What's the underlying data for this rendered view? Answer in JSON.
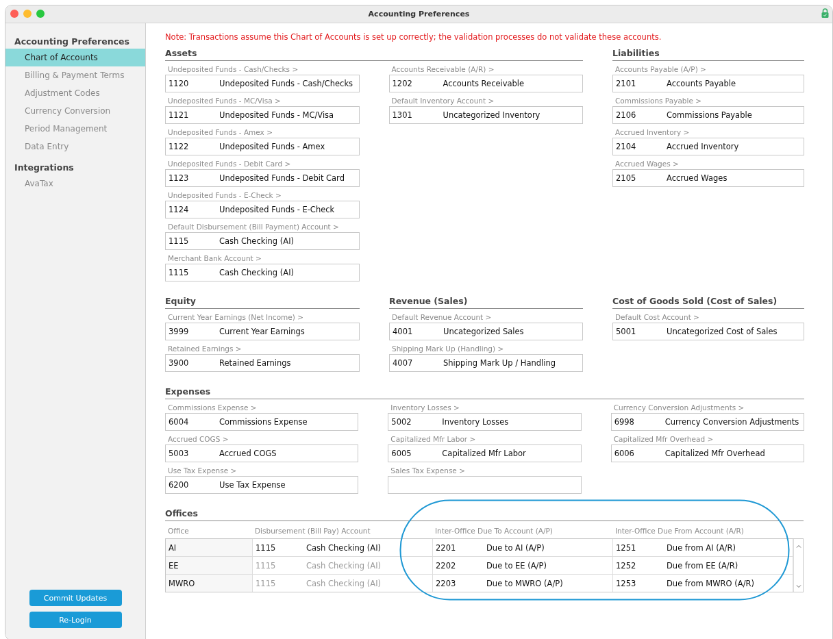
{
  "window": {
    "title": "Accounting Preferences"
  },
  "sidebar": {
    "groups": [
      {
        "title": "Accounting Preferences",
        "items": [
          {
            "label": "Chart of Accounts",
            "selected": true
          },
          {
            "label": "Billing & Payment Terms",
            "selected": false
          },
          {
            "label": "Adjustment Codes",
            "selected": false
          },
          {
            "label": "Currency Conversion",
            "selected": false
          },
          {
            "label": "Period Management",
            "selected": false
          },
          {
            "label": "Data Entry",
            "selected": false
          }
        ]
      },
      {
        "title": "Integrations",
        "items": [
          {
            "label": "AvaTax",
            "selected": false
          }
        ]
      }
    ],
    "buttons": [
      "Commit Updates",
      "Re-Login"
    ]
  },
  "note": "Note: Transactions assume this Chart of Accounts is set up correctly; the validation processes do not validate these accounts.",
  "section_rows": [
    [
      {
        "title": "Assets",
        "columns": [
          [
            {
              "label": "Undeposited Funds - Cash/Checks >",
              "number": "1120",
              "name": "Undeposited Funds - Cash/Checks"
            },
            {
              "label": "Undeposited Funds - MC/Visa >",
              "number": "1121",
              "name": "Undeposited Funds - MC/Visa"
            },
            {
              "label": "Undeposited Funds - Amex >",
              "number": "1122",
              "name": "Undeposited Funds - Amex"
            },
            {
              "label": "Undeposited Funds - Debit Card >",
              "number": "1123",
              "name": "Undeposited Funds - Debit Card"
            },
            {
              "label": "Undeposited Funds - E-Check >",
              "number": "1124",
              "name": "Undeposited Funds - E-Check"
            },
            {
              "label": "Default Disbursement (Bill Payment) Account >",
              "number": "1115",
              "name": "Cash Checking (AI)"
            },
            {
              "label": "Merchant Bank Account >",
              "number": "1115",
              "name": "Cash Checking (AI)"
            }
          ],
          [
            {
              "label": "Accounts Receivable (A/R) >",
              "number": "1202",
              "name": "Accounts Receivable"
            },
            {
              "label": "Default Inventory Account >",
              "number": "1301",
              "name": "Uncategorized Inventory"
            }
          ]
        ]
      },
      {
        "title": "Liabilities",
        "columns": [
          [
            {
              "label": "Accounts Payable (A/P) >",
              "number": "2101",
              "name": "Accounts Payable"
            },
            {
              "label": "Commissions Payable >",
              "number": "2106",
              "name": "Commissions Payable"
            },
            {
              "label": "Accrued Inventory >",
              "number": "2104",
              "name": "Accrued Inventory"
            },
            {
              "label": "Accrued Wages >",
              "number": "2105",
              "name": "Accrued Wages"
            }
          ]
        ]
      }
    ],
    [
      {
        "title": "Equity",
        "columns": [
          [
            {
              "label": "Current Year Earnings (Net Income) >",
              "number": "3999",
              "name": "Current Year Earnings"
            },
            {
              "label": "Retained Earnings >",
              "number": "3900",
              "name": "Retained Earnings"
            }
          ]
        ]
      },
      {
        "title": "Revenue (Sales)",
        "columns": [
          [
            {
              "label": "Default Revenue Account >",
              "number": "4001",
              "name": "Uncategorized Sales"
            },
            {
              "label": "Shipping Mark Up (Handling) >",
              "number": "4007",
              "name": "Shipping Mark Up / Handling"
            }
          ]
        ]
      },
      {
        "title": "Cost of Goods Sold (Cost of Sales)",
        "columns": [
          [
            {
              "label": "Default Cost Account >",
              "number": "5001",
              "name": "Uncategorized Cost of Sales"
            }
          ]
        ]
      }
    ],
    [
      {
        "title": "Expenses",
        "columns": [
          [
            {
              "label": "Commissions Expense >",
              "number": "6004",
              "name": "Commissions Expense"
            },
            {
              "label": "Accrued COGS >",
              "number": "5003",
              "name": "Accrued COGS"
            },
            {
              "label": "Use Tax Expense >",
              "number": "6200",
              "name": "Use Tax Expense"
            }
          ],
          [
            {
              "label": "Inventory Losses >",
              "number": "5002",
              "name": "Inventory Losses"
            },
            {
              "label": "Capitalized Mfr Labor >",
              "number": "6005",
              "name": "Capitalized Mfr Labor"
            },
            {
              "label": "Sales Tax Expense >"
            }
          ],
          [
            {
              "label": "Currency Conversion Adjustments >",
              "number": "6998",
              "name": "Currency Conversion Adjustments"
            },
            {
              "label": "Capitalized Mfr Overhead >",
              "number": "6006",
              "name": "Capitalized Mfr Overhead"
            }
          ]
        ]
      }
    ]
  ],
  "offices": {
    "title": "Offices",
    "columns": [
      "Office",
      "Disbursement (Bill Pay) Account",
      "Inter-Office Due To Account (A/P)",
      "Inter-Office Due From Account (A/R)"
    ],
    "rows": [
      {
        "office": "AI",
        "accounts": [
          {
            "number": "1115",
            "name": "Cash Checking (AI)",
            "dimmed": false
          },
          {
            "number": "2201",
            "name": "Due to AI (A/P)",
            "dimmed": false
          },
          {
            "number": "1251",
            "name": "Due from AI (A/R)",
            "dimmed": false
          }
        ]
      },
      {
        "office": "EE",
        "accounts": [
          {
            "number": "1115",
            "name": "Cash Checking (AI)",
            "dimmed": true
          },
          {
            "number": "2202",
            "name": "Due to EE (A/P)",
            "dimmed": false
          },
          {
            "number": "1252",
            "name": "Due from EE (A/R)",
            "dimmed": false
          }
        ]
      },
      {
        "office": "MWRO",
        "accounts": [
          {
            "number": "1115",
            "name": "Cash Checking (AI)",
            "dimmed": true
          },
          {
            "number": "2203",
            "name": "Due to MWRO (A/P)",
            "dimmed": false
          },
          {
            "number": "1253",
            "name": "Due from MWRO (A/R)",
            "dimmed": false
          }
        ]
      }
    ],
    "annotation": {
      "kind": "ellipse"
    }
  }
}
